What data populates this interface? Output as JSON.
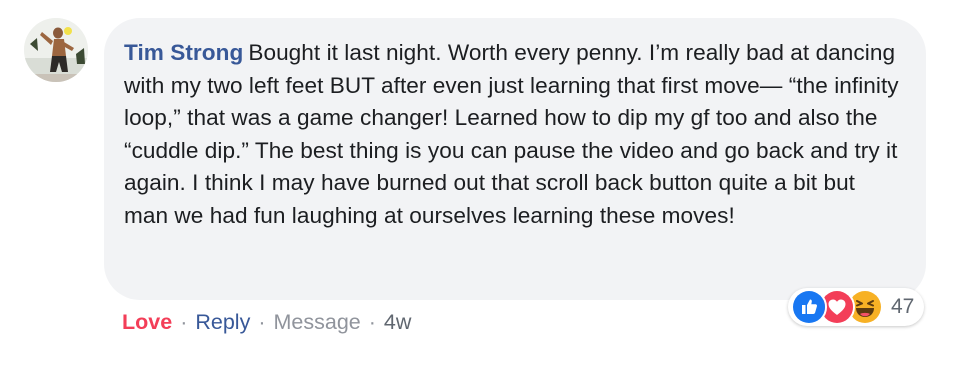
{
  "comment": {
    "author": "Tim Strong",
    "text": "Bought it last night. Worth every penny. I’m really bad at dancing with my two left feet BUT after even just learning that first move— “the infinity loop,” that was a game changer! Learned how to dip my gf too and also the “cuddle dip.” The best thing is you can pause the video and go back and try it again. I think I may have burned out that scroll back button quite a bit but man we had fun laughing at ourselves learning these moves!",
    "reactions": {
      "icons": [
        "like-icon",
        "love-icon",
        "haha-icon"
      ],
      "count": "47"
    },
    "actions": {
      "love_label": "Love",
      "reply_label": "Reply",
      "message_label": "Message",
      "separator": "·",
      "time": "4w"
    }
  },
  "colors": {
    "bubble_bg": "#f2f3f5",
    "author_name": "#385898",
    "love_action": "#f33e58",
    "like_blue": "#1877f2",
    "love_red": "#f33e58",
    "haha_yellow": "#f7b125"
  }
}
